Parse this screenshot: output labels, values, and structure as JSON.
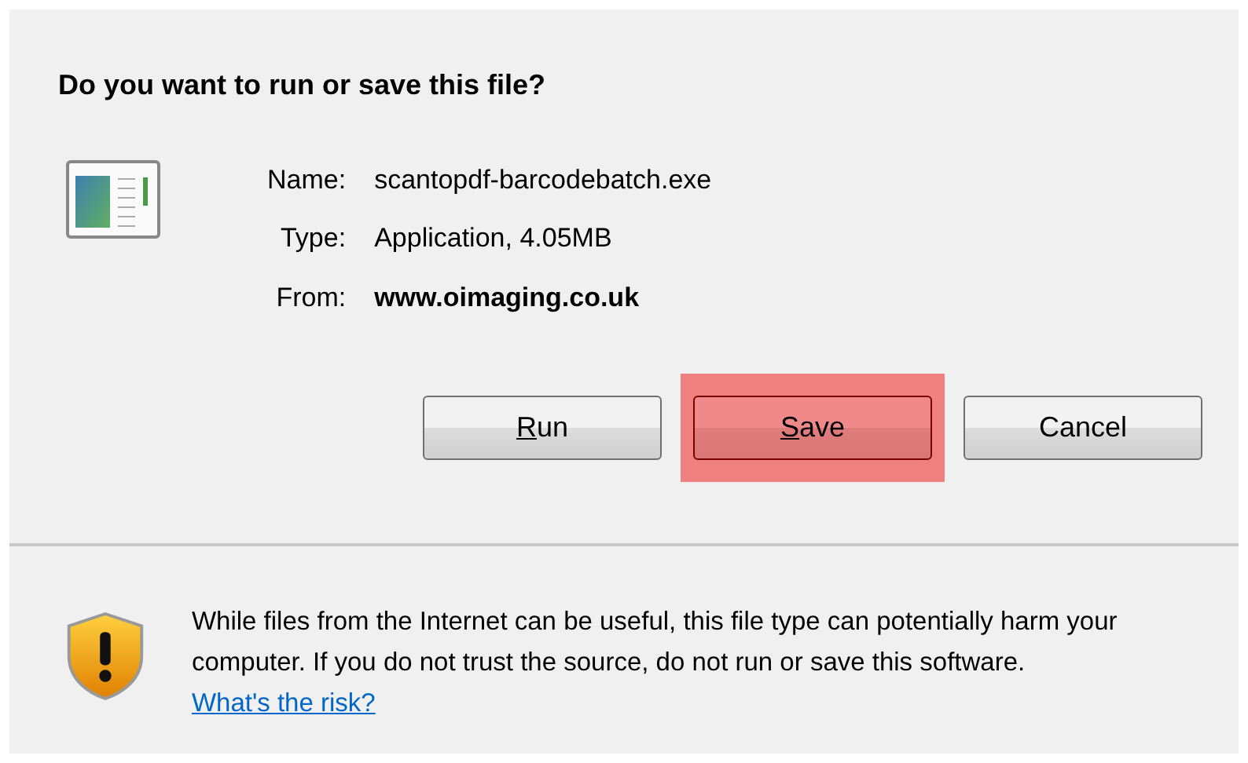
{
  "dialog": {
    "title": "Do you want to run or save this file?",
    "fields": [
      {
        "label": "Name:",
        "value": "scantopdf-barcodebatch.exe",
        "bold": false
      },
      {
        "label": "Type:",
        "value": "Application, 4.05MB",
        "bold": false
      },
      {
        "label": "From:",
        "value": "www.oimaging.co.uk",
        "bold": true
      }
    ],
    "buttons": [
      {
        "access_key": "R",
        "rest": "un",
        "highlighted": false
      },
      {
        "access_key": "S",
        "rest": "ave",
        "highlighted": true
      },
      {
        "rest": "Cancel",
        "highlighted": false
      }
    ],
    "warning": {
      "text": "While files from the Internet can be useful, this file type can potentially harm your computer. If you do not trust the source, do not run or save this software.",
      "link": "What's the risk?"
    }
  }
}
